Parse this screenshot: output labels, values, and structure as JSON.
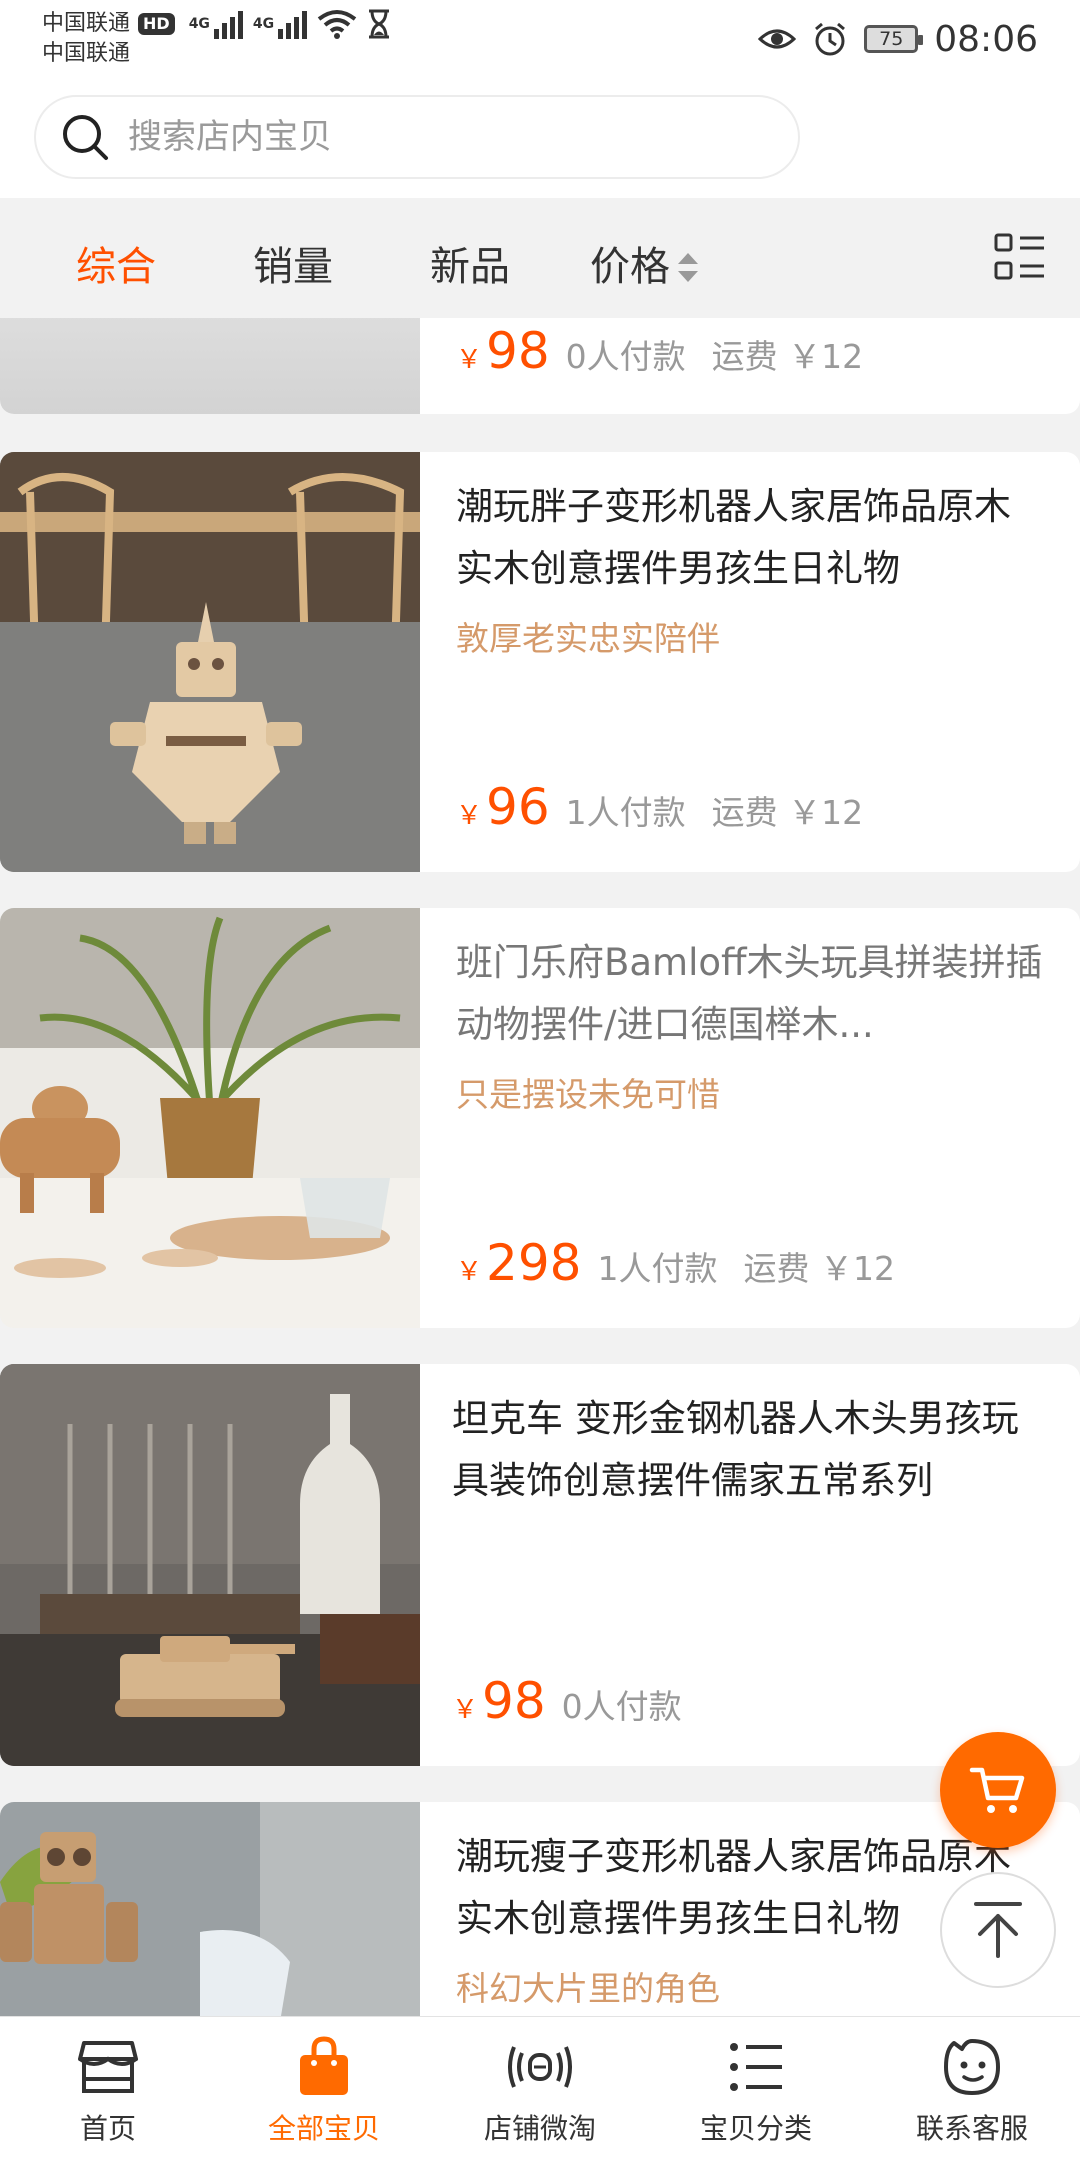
{
  "status_bar": {
    "carrier1": "中国联通",
    "hd": "HD",
    "carrier2": "中国联通",
    "net1": "4G",
    "net2": "4G",
    "battery": "75",
    "time": "08:06"
  },
  "search": {
    "placeholder": "搜索店内宝贝"
  },
  "sort_tabs": {
    "comprehensive": "综合",
    "sales": "销量",
    "new": "新品",
    "price": "价格"
  },
  "products": [
    {
      "price": "98",
      "payers": "0人付款",
      "shipping": "运费 ￥12"
    },
    {
      "title": "潮玩胖子变形机器人家居饰品原木实木创意摆件男孩生日礼物",
      "tagline": "敦厚老实忠实陪伴",
      "price": "96",
      "payers": "1人付款",
      "shipping": "运费 ￥12"
    },
    {
      "title": "班门乐府Bamloff木头玩具拼装拼插动物摆件/进口德国榉木...",
      "tagline": "只是摆设未免可惜",
      "price": "298",
      "payers": "1人付款",
      "shipping": "运费 ￥12"
    },
    {
      "title": "坦克车 变形金钢机器人木头男孩玩具装饰创意摆件儒家五常系列",
      "price": "98",
      "payers": "0人付款"
    },
    {
      "title": "潮玩瘦子变形机器人家居饰品原木实木创意摆件男孩生日礼物",
      "tagline": "科幻大片里的角色"
    }
  ],
  "currency": "￥",
  "bottom_nav": {
    "home": "首页",
    "all": "全部宝贝",
    "micro": "店铺微淘",
    "category": "宝贝分类",
    "service": "联系客服"
  },
  "colors": {
    "accent": "#ff5000",
    "fab": "#ff6a00",
    "tagline": "#d59a6a"
  }
}
